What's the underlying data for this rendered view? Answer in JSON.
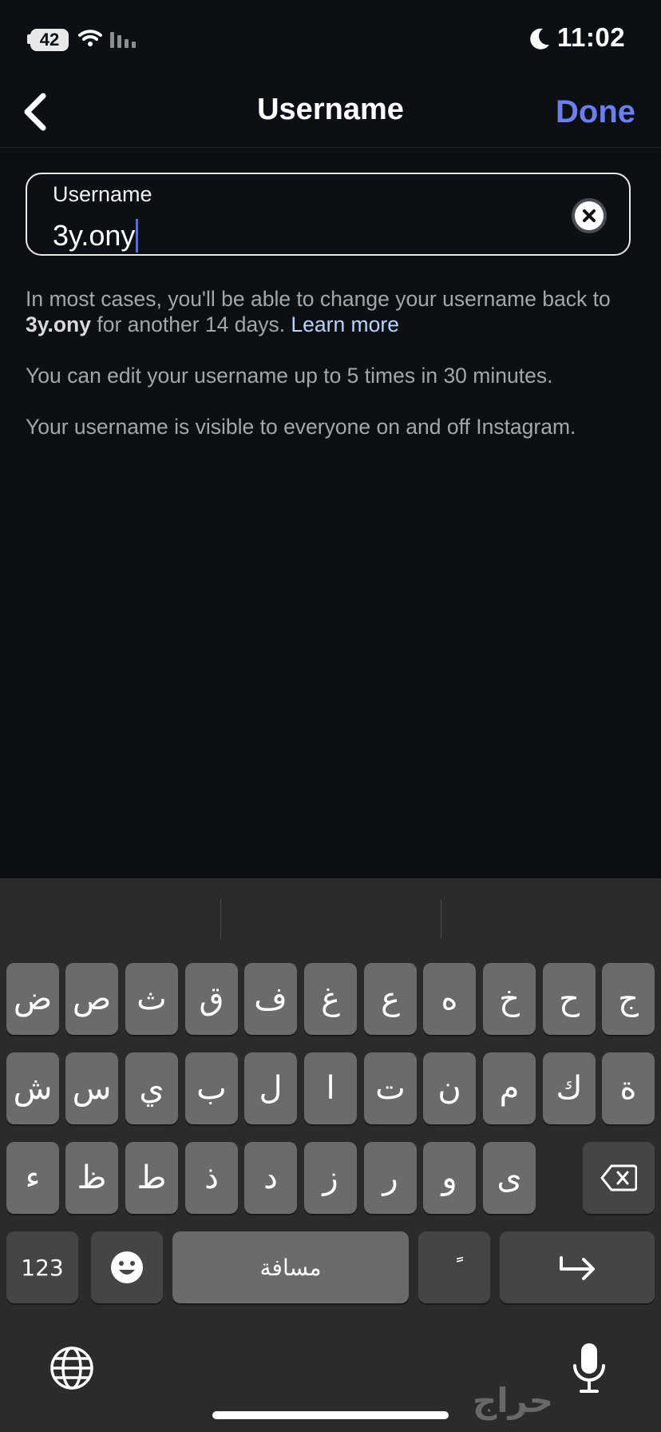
{
  "status_bar": {
    "battery": "42",
    "time": "11:02"
  },
  "header": {
    "title": "Username",
    "done_label": "Done"
  },
  "field": {
    "label": "Username",
    "value": "3y.ony"
  },
  "help": {
    "p1_prefix": "In most cases, you'll be able to change your username back to ",
    "p1_username": "3y.ony",
    "p1_suffix": " for another 14 days. ",
    "p1_link": "Learn more",
    "p2": "You can edit your username up to 5 times in 30 minutes.",
    "p3": "Your username is visible to everyone on and off Instagram."
  },
  "keyboard": {
    "row1": [
      "ض",
      "ص",
      "ث",
      "ق",
      "ف",
      "غ",
      "ع",
      "ه",
      "خ",
      "ح",
      "ج"
    ],
    "row2": [
      "ش",
      "س",
      "ي",
      "ب",
      "ل",
      "ا",
      "ت",
      "ن",
      "م",
      "ك",
      "ة"
    ],
    "row3": [
      "ء",
      "ظ",
      "ط",
      "ذ",
      "د",
      "ز",
      "ر",
      "و",
      "ى"
    ],
    "numbers_label": "123",
    "space_label": "مسافة",
    "diacritic_label": "ًً"
  },
  "watermark": "حراج",
  "icons": [
    "back-chevron-icon",
    "clear-icon",
    "backspace-icon",
    "emoji-icon",
    "return-icon",
    "globe-icon",
    "microphone-icon",
    "wifi-icon",
    "moon-icon"
  ],
  "colors": {
    "background": "#0c0f14",
    "accent": "#6a7ff0",
    "link": "#b8d3ff",
    "keyboard": "#2b2b2d",
    "key": "#6b6b6e"
  }
}
